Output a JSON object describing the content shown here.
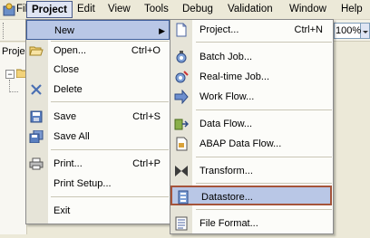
{
  "menubar": {
    "items": [
      {
        "label": "File"
      },
      {
        "label": "Project"
      },
      {
        "label": "Edit"
      },
      {
        "label": "View"
      },
      {
        "label": "Tools"
      },
      {
        "label": "Debug"
      },
      {
        "label": "Validation"
      },
      {
        "label": "Window"
      },
      {
        "label": "Help"
      }
    ]
  },
  "toolbar": {
    "zoom_value": "100%"
  },
  "left_panel": {
    "title": "Proje"
  },
  "project_menu": {
    "items": [
      {
        "label": "New",
        "shortcut": "",
        "icon": "none",
        "has_submenu": true
      },
      {
        "label": "Open...",
        "shortcut": "Ctrl+O",
        "icon": "open-folder-icon"
      },
      {
        "label": "Close",
        "shortcut": "",
        "icon": "none"
      },
      {
        "label": "Delete",
        "shortcut": "",
        "icon": "delete-x-icon"
      },
      {
        "label": "Save",
        "shortcut": "Ctrl+S",
        "icon": "save-disk-icon"
      },
      {
        "label": "Save All",
        "shortcut": "",
        "icon": "save-all-icon"
      },
      {
        "label": "Print...",
        "shortcut": "Ctrl+P",
        "icon": "printer-icon"
      },
      {
        "label": "Print Setup...",
        "shortcut": "",
        "icon": "none"
      },
      {
        "label": "Exit",
        "shortcut": "",
        "icon": "none"
      }
    ]
  },
  "new_submenu": {
    "items": [
      {
        "label": "Project...",
        "shortcut": "Ctrl+N",
        "icon": "project-icon"
      },
      {
        "label": "Batch Job...",
        "shortcut": "",
        "icon": "batch-job-icon"
      },
      {
        "label": "Real-time Job...",
        "shortcut": "",
        "icon": "realtime-job-icon"
      },
      {
        "label": "Work Flow...",
        "shortcut": "",
        "icon": "work-flow-icon"
      },
      {
        "label": "Data Flow...",
        "shortcut": "",
        "icon": "data-flow-icon"
      },
      {
        "label": "ABAP Data Flow...",
        "shortcut": "",
        "icon": "abap-data-flow-icon"
      },
      {
        "label": "Transform...",
        "shortcut": "",
        "icon": "transform-icon"
      },
      {
        "label": "Datastore...",
        "shortcut": "",
        "icon": "datastore-icon",
        "highlighted": true
      },
      {
        "label": "File Format...",
        "shortcut": "",
        "icon": "file-format-icon"
      }
    ]
  },
  "colors": {
    "menu_background": "#fcfcf9",
    "gutter": "#e6e4d8",
    "highlight": "#b9c7e6",
    "highlight_border": "#a5543a"
  }
}
